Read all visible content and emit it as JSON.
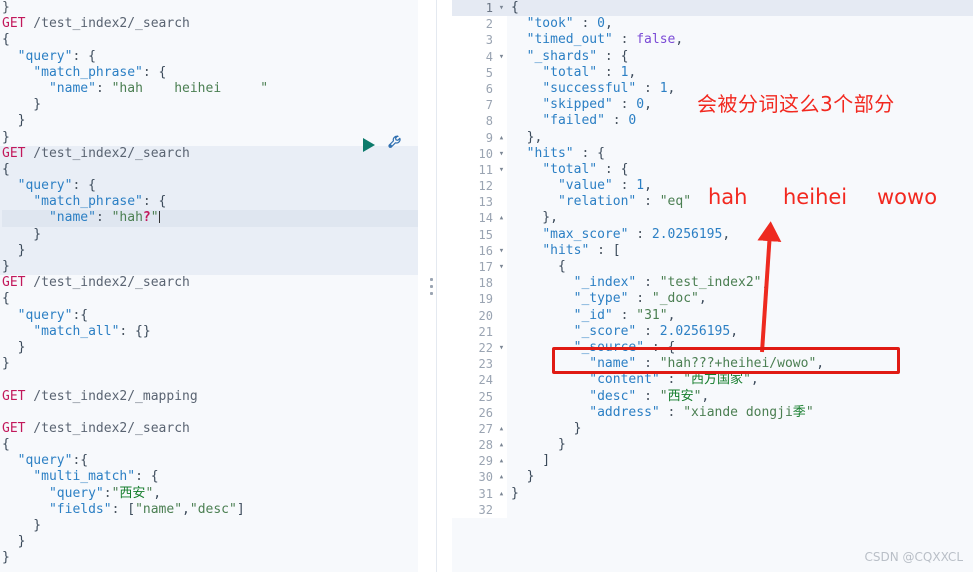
{
  "editor": {
    "top_fragment": "}",
    "blocks": [
      {
        "id": "block-1",
        "active": false,
        "lines": [
          {
            "method": "GET",
            "url": " /test_index2/_search"
          },
          {
            "text": "{"
          },
          {
            "text": "  \"query\": {"
          },
          {
            "text": "    \"match_phrase\": {"
          },
          {
            "text": "      \"name\": \"hah    heihei     \""
          },
          {
            "text": "    }"
          },
          {
            "text": "  }"
          },
          {
            "text": "}"
          }
        ]
      },
      {
        "id": "block-2",
        "active": true,
        "lines": [
          {
            "method": "GET",
            "url": " /test_index2/_search"
          },
          {
            "text": "{"
          },
          {
            "text": "  \"query\": {"
          },
          {
            "text": "    \"match_phrase\": {"
          },
          {
            "text": "      \"name\": \"hah?\"",
            "cursor": true
          },
          {
            "text": "    }"
          },
          {
            "text": "  }"
          },
          {
            "text": "}"
          }
        ]
      },
      {
        "id": "block-3",
        "active": false,
        "lines": [
          {
            "method": "GET",
            "url": " /test_index2/_search"
          },
          {
            "text": "{"
          },
          {
            "text": "  \"query\":{"
          },
          {
            "text": "    \"match_all\": {}"
          },
          {
            "text": "  }"
          },
          {
            "text": "}"
          },
          {
            "text": ""
          }
        ]
      },
      {
        "id": "block-4",
        "active": false,
        "lines": [
          {
            "method": "GET",
            "url": " /test_index2/_mapping"
          },
          {
            "text": ""
          }
        ]
      },
      {
        "id": "block-5",
        "active": false,
        "lines": [
          {
            "method": "GET",
            "url": " /test_index2/_search"
          },
          {
            "text": "{"
          },
          {
            "text": "  \"query\":{"
          },
          {
            "text": "    \"multi_match\": {"
          },
          {
            "text": "      \"query\":\"西安\","
          },
          {
            "text": "      \"fields\": [\"name\",\"desc\"]"
          },
          {
            "text": "    }"
          },
          {
            "text": "  }"
          },
          {
            "text": "}"
          }
        ]
      }
    ],
    "actions": {
      "run_label": "run-query",
      "wrench_label": "query-tools"
    }
  },
  "response": {
    "lines": [
      {
        "n": "1",
        "fold": "▾",
        "text": "{"
      },
      {
        "n": "2",
        "fold": "",
        "text": "  \"took\" : 0,"
      },
      {
        "n": "3",
        "fold": "",
        "text": "  \"timed_out\" : false,"
      },
      {
        "n": "4",
        "fold": "▾",
        "text": "  \"_shards\" : {"
      },
      {
        "n": "5",
        "fold": "",
        "text": "    \"total\" : 1,"
      },
      {
        "n": "6",
        "fold": "",
        "text": "    \"successful\" : 1,"
      },
      {
        "n": "7",
        "fold": "",
        "text": "    \"skipped\" : 0,"
      },
      {
        "n": "8",
        "fold": "",
        "text": "    \"failed\" : 0"
      },
      {
        "n": "9",
        "fold": "▴",
        "text": "  },"
      },
      {
        "n": "10",
        "fold": "▾",
        "text": "  \"hits\" : {"
      },
      {
        "n": "11",
        "fold": "▾",
        "text": "    \"total\" : {"
      },
      {
        "n": "12",
        "fold": "",
        "text": "      \"value\" : 1,"
      },
      {
        "n": "13",
        "fold": "",
        "text": "      \"relation\" : \"eq\""
      },
      {
        "n": "14",
        "fold": "▴",
        "text": "    },"
      },
      {
        "n": "15",
        "fold": "",
        "text": "    \"max_score\" : 2.0256195,"
      },
      {
        "n": "16",
        "fold": "▾",
        "text": "    \"hits\" : ["
      },
      {
        "n": "17",
        "fold": "▾",
        "text": "      {"
      },
      {
        "n": "18",
        "fold": "",
        "text": "        \"_index\" : \"test_index2\","
      },
      {
        "n": "19",
        "fold": "",
        "text": "        \"_type\" : \"_doc\","
      },
      {
        "n": "20",
        "fold": "",
        "text": "        \"_id\" : \"31\","
      },
      {
        "n": "21",
        "fold": "",
        "text": "        \"_score\" : 2.0256195,"
      },
      {
        "n": "22",
        "fold": "▾",
        "text": "        \"_source\" : {"
      },
      {
        "n": "23",
        "fold": "",
        "text": "          \"name\" : \"hah???+heihei/wowo\","
      },
      {
        "n": "24",
        "fold": "",
        "text": "          \"content\" : \"西方国家\","
      },
      {
        "n": "25",
        "fold": "",
        "text": "          \"desc\" : \"西安\","
      },
      {
        "n": "26",
        "fold": "",
        "text": "          \"address\" : \"xiande dongji季\""
      },
      {
        "n": "27",
        "fold": "▴",
        "text": "        }"
      },
      {
        "n": "28",
        "fold": "▴",
        "text": "      }"
      },
      {
        "n": "29",
        "fold": "▴",
        "text": "    ]"
      },
      {
        "n": "30",
        "fold": "▴",
        "text": "  }"
      },
      {
        "n": "31",
        "fold": "▴",
        "text": "}"
      },
      {
        "n": "32",
        "fold": "",
        "text": ""
      }
    ]
  },
  "annotations": {
    "note_cn": "会被分词这么3个部分",
    "terms": [
      "hah",
      "heihei",
      "wowo"
    ],
    "accent_red": "#f2281f",
    "box_red": "#e01b14"
  },
  "watermark": "CSDN @CQXXCL"
}
